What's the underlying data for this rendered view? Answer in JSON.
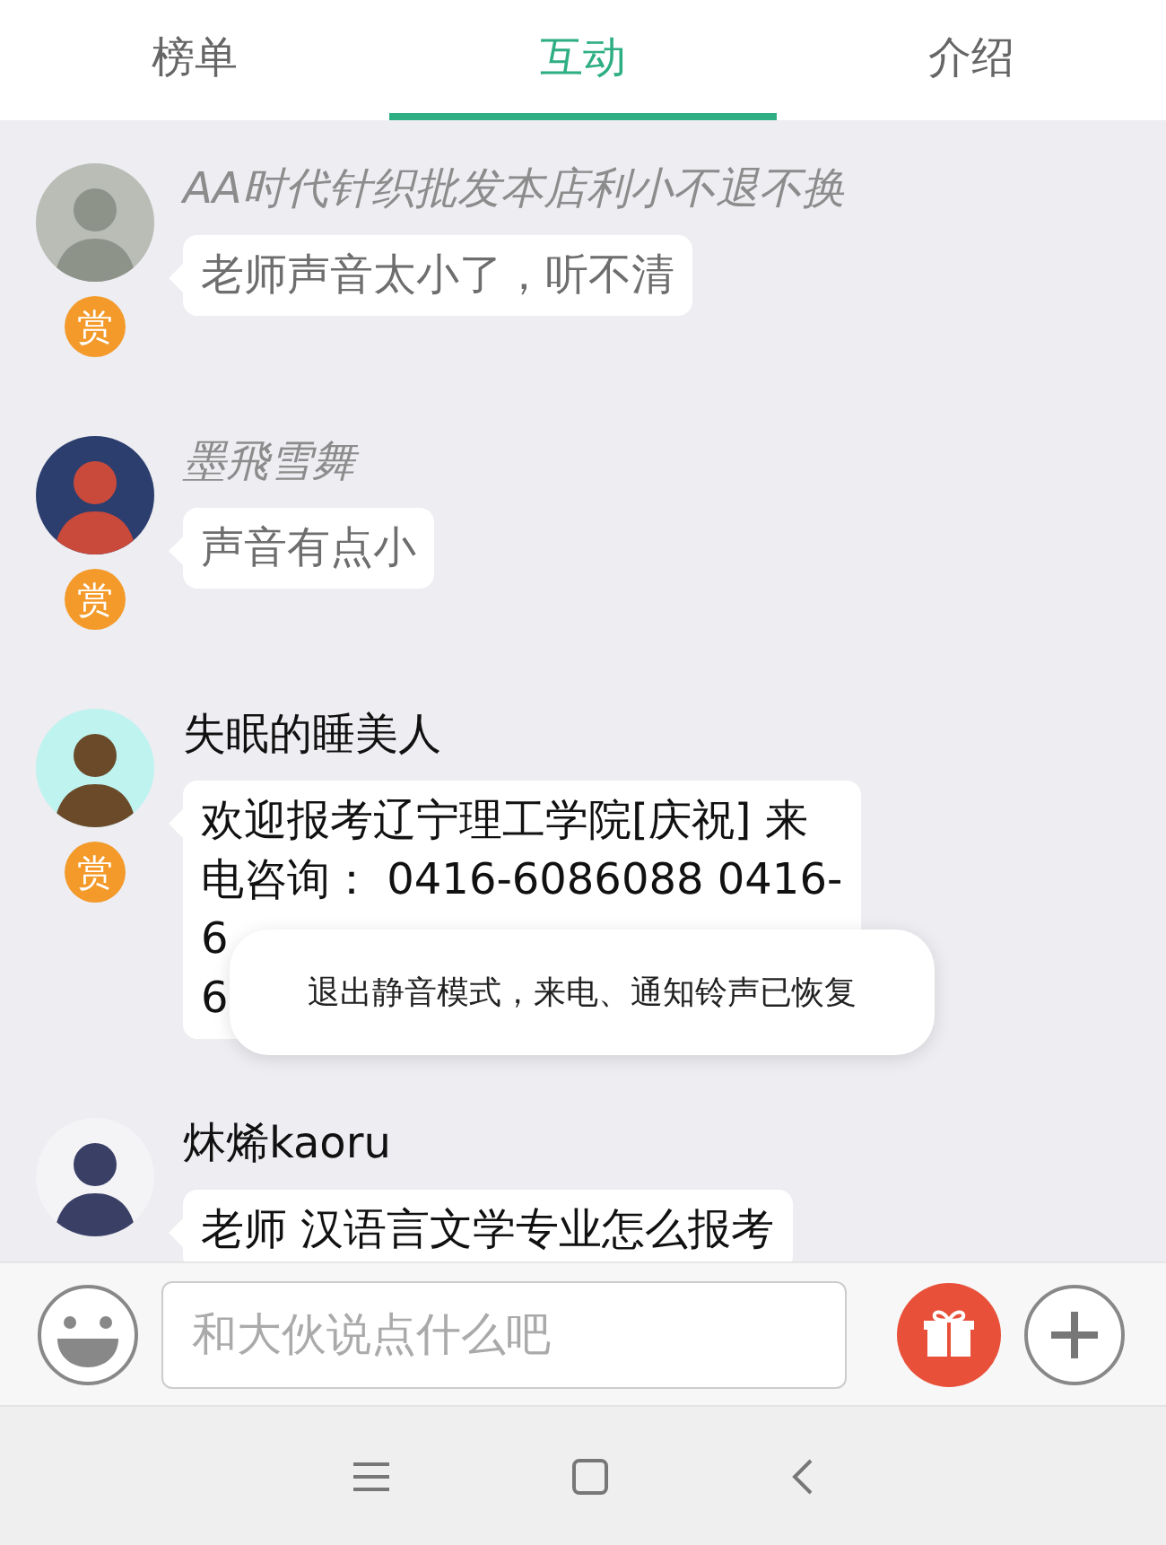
{
  "tabs": [
    {
      "label": "榜单",
      "selected": false
    },
    {
      "label": "互动",
      "selected": true
    },
    {
      "label": "介绍",
      "selected": false
    }
  ],
  "messages": [
    {
      "name": "AA时代针织批发本店利小不退不换",
      "dimmed": true,
      "lines": [
        "老师声音太小了，听不清"
      ],
      "reward": "赏"
    },
    {
      "name": "墨飛雪舞",
      "dimmed": true,
      "lines": [
        "声音有点小"
      ],
      "reward": "赏"
    },
    {
      "name": "失眠的睡美人",
      "dimmed": false,
      "lines": [
        "欢迎报考辽宁理工学院[庆祝] 来",
        "电咨询： 0416-6086088 0416-",
        "6",
        "6"
      ],
      "reward": "赏"
    },
    {
      "name": "炑烯kaoru",
      "dimmed": false,
      "lines": [
        "老师 汉语言文学专业怎么报考"
      ]
    }
  ],
  "toast": {
    "text": "退出静音模式，来电、通知铃声已恢复"
  },
  "composer": {
    "placeholder": "和大伙说点什么吧"
  }
}
